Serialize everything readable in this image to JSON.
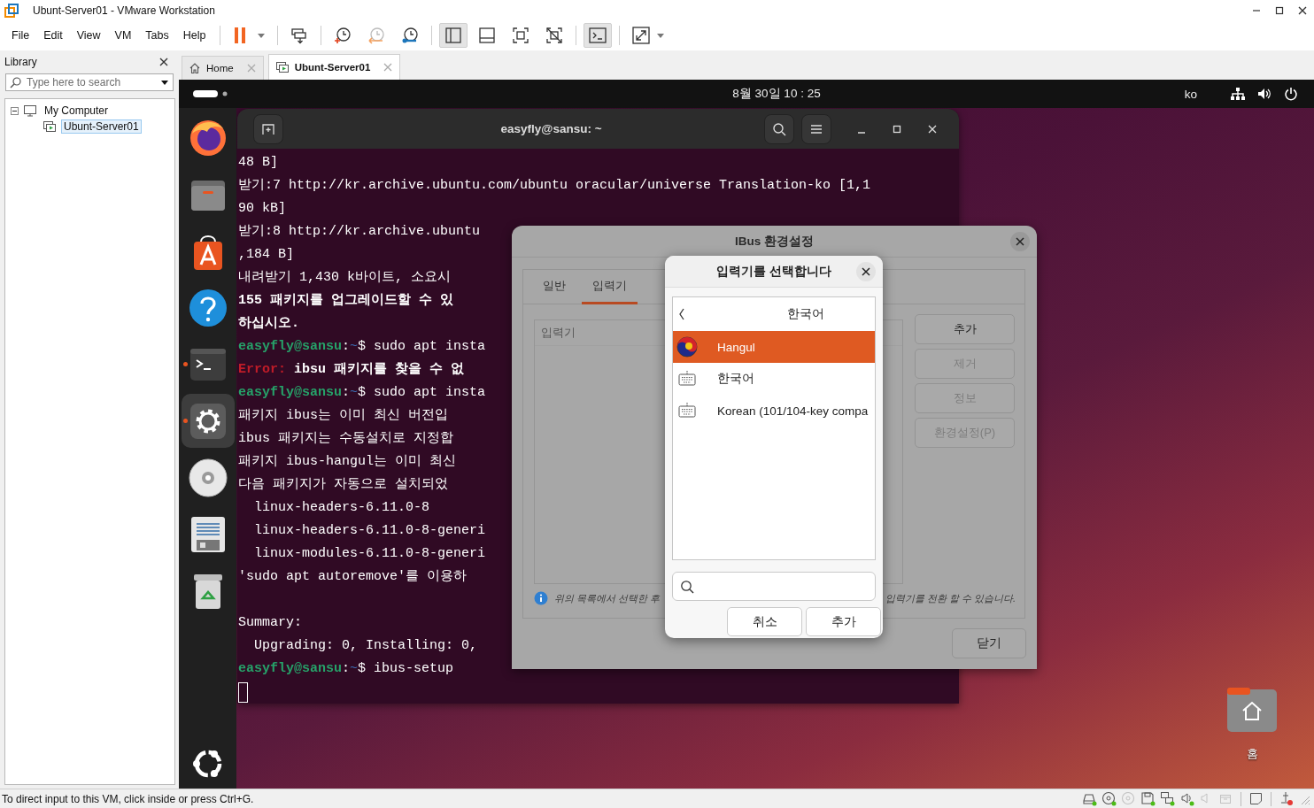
{
  "window": {
    "title": "Ubunt-Server01 - VMware Workstation"
  },
  "menu": [
    "File",
    "Edit",
    "View",
    "VM",
    "Tabs",
    "Help"
  ],
  "toolbar": [
    [
      {
        "kind": "pause",
        "pressed": false,
        "dropdown": true
      }
    ],
    [
      {
        "kind": "send-keys",
        "pressed": false,
        "dropdown": false
      }
    ],
    [
      {
        "kind": "snapshot",
        "pressed": false,
        "dropdown": false
      },
      {
        "kind": "revert",
        "pressed": false,
        "dropdown": false
      },
      {
        "kind": "snapshot-manager",
        "pressed": false,
        "dropdown": false
      }
    ],
    [
      {
        "kind": "library-view",
        "pressed": true,
        "dropdown": false
      },
      {
        "kind": "thumbnail-view",
        "pressed": false,
        "dropdown": false
      },
      {
        "kind": "full-view",
        "pressed": false,
        "dropdown": false
      },
      {
        "kind": "unity",
        "pressed": false,
        "dropdown": false
      }
    ],
    [
      {
        "kind": "console",
        "pressed": true,
        "dropdown": false
      }
    ],
    [
      {
        "kind": "stretch",
        "pressed": false,
        "dropdown": true
      }
    ]
  ],
  "library": {
    "title": "Library",
    "search": {
      "placeholder": "Type here to search"
    },
    "tree": [
      {
        "label": "My Computer",
        "expanded": true,
        "selected": false,
        "children": [
          {
            "label": "Ubunt-Server01",
            "selected": true
          }
        ]
      }
    ]
  },
  "vm_tabs": [
    {
      "kind": "home",
      "label": "Home",
      "selected": false
    },
    {
      "kind": "vm",
      "label": "Ubunt-Server01",
      "selected": true
    }
  ],
  "guest": {
    "top_bar": {
      "clock": "8월 30일 10 : 25",
      "input_source": "ko"
    },
    "dock": [
      {
        "kind": "browser",
        "running": false,
        "focused": false
      },
      {
        "kind": "files",
        "running": false,
        "focused": false
      },
      {
        "kind": "app-center",
        "running": false,
        "focused": false
      },
      {
        "kind": "help",
        "running": false,
        "focused": false
      },
      {
        "kind": "terminal",
        "running": true,
        "focused": false
      },
      {
        "kind": "settings",
        "running": true,
        "focused": true
      },
      {
        "kind": "disc",
        "running": false,
        "focused": false
      },
      {
        "kind": "document",
        "running": false,
        "focused": false
      },
      {
        "kind": "trash",
        "running": false,
        "focused": false
      }
    ],
    "terminal": {
      "title": "easyfly@sansu: ~",
      "lines": [
        {
          "kind": "plain",
          "text": "48 B]"
        },
        {
          "kind": "plain",
          "text": "받기:7 http://kr.archive.ubuntu.com/ubuntu oracular/universe Translation-ko [1,1"
        },
        {
          "kind": "plain",
          "text": "90 kB]"
        },
        {
          "kind": "plain",
          "text": "받기:8 http://kr.archive.ubuntu"
        },
        {
          "kind": "plain",
          "text": ",184 B]"
        },
        {
          "kind": "plain",
          "text": "내려받기 1,430 k바이트, 소요시"
        },
        {
          "kind": "bold",
          "text": "155 패키지를 업그레이드할 수 있"
        },
        {
          "kind": "bold",
          "text": "하십시오."
        },
        {
          "kind": "prompt",
          "user": "easyfly@sansu",
          "sep": ":",
          "path": "~",
          "command": "$ sudo apt insta"
        },
        {
          "kind": "error",
          "label": "Error:",
          "text": "ibsu 패키지를 찾을 수 없"
        },
        {
          "kind": "prompt",
          "user": "easyfly@sansu",
          "sep": ":",
          "path": "~",
          "command": "$ sudo apt insta"
        },
        {
          "kind": "plain",
          "text": "패키지 ibus는 이미 최신 버전입"
        },
        {
          "kind": "plain",
          "text": "ibus 패키지는 수동설치로 지정합"
        },
        {
          "kind": "plain",
          "text": "패키지 ibus-hangul는 이미 최신"
        },
        {
          "kind": "plain",
          "text": "다음 패키지가 자동으로 설치되었"
        },
        {
          "kind": "plain",
          "text": "  linux-headers-6.11.0-8"
        },
        {
          "kind": "plain",
          "text": "  linux-headers-6.11.0-8-generi"
        },
        {
          "kind": "plain",
          "text": "  linux-modules-6.11.0-8-generi"
        },
        {
          "kind": "plain",
          "text": "'sudo apt autoremove'를 이용하"
        },
        {
          "kind": "blank"
        },
        {
          "kind": "plain",
          "text": "Summary:"
        },
        {
          "kind": "plain",
          "text": "  Upgrading: 0, Installing: 0,"
        },
        {
          "kind": "prompt",
          "user": "easyfly@sansu",
          "sep": ":",
          "path": "~",
          "command": "$ ibus-setup"
        },
        {
          "kind": "cursor"
        }
      ]
    },
    "ibus_preferences": {
      "title": "IBus 환경설정",
      "tabs": [
        {
          "label": "일반",
          "selected": false
        },
        {
          "label": "입력기",
          "selected": true
        }
      ],
      "list_header": "입력기",
      "buttons": [
        {
          "label": "추가",
          "disabled": false
        },
        {
          "label": "제거",
          "disabled": true
        },
        {
          "label": "정보",
          "disabled": true
        },
        {
          "label": "환경설정(P)",
          "disabled": true
        }
      ],
      "hint_start": "위의 목록에서 선택한 후",
      "hint_end": "입력기를 전환 할 수 있습니다.",
      "close_button": "닫기"
    },
    "input_method_dialog": {
      "title": "입력기를 선택합니다",
      "language": "한국어",
      "engines": [
        {
          "kind": "ime",
          "label": "Hangul",
          "selected": true
        },
        {
          "kind": "keyboard",
          "label": "한국어",
          "selected": false
        },
        {
          "kind": "keyboard",
          "label": "Korean (101/104-key compa",
          "selected": false
        }
      ],
      "buttons": [
        "취소",
        "추가"
      ]
    },
    "desktop_icons": [
      {
        "kind": "home",
        "label": "홈"
      }
    ]
  },
  "status_bar": {
    "text": "To direct input to this VM, click inside or press Ctrl+G.",
    "devices": [
      {
        "kind": "hard-disk",
        "connected": true
      },
      {
        "kind": "cd",
        "connected": true
      },
      {
        "kind": "cd",
        "connected": false
      },
      {
        "kind": "floppy",
        "connected": true
      },
      {
        "kind": "network",
        "connected": true
      },
      {
        "kind": "sound",
        "connected": true
      },
      {
        "kind": "speaker",
        "connected": false
      },
      {
        "kind": "printer",
        "connected": false
      }
    ]
  }
}
